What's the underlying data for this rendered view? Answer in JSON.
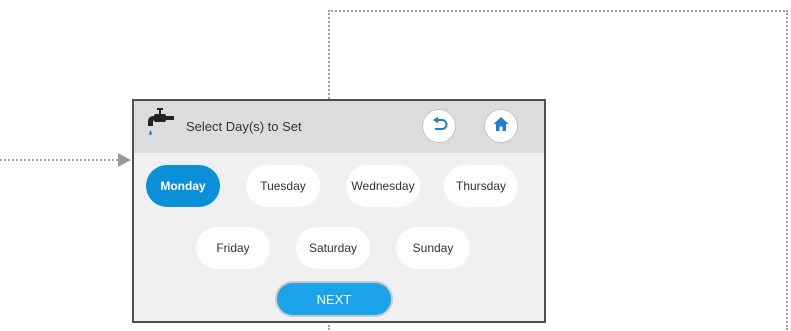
{
  "header": {
    "title": "Select Day(s) to Set",
    "icon": "water-tap-icon",
    "back_icon": "back-arrow-icon",
    "home_icon": "home-icon"
  },
  "days": [
    {
      "label": "Monday",
      "selected": true
    },
    {
      "label": "Tuesday",
      "selected": false
    },
    {
      "label": "Wednesday",
      "selected": false
    },
    {
      "label": "Thursday",
      "selected": false
    },
    {
      "label": "Friday",
      "selected": false
    },
    {
      "label": "Saturday",
      "selected": false
    },
    {
      "label": "Sunday",
      "selected": false
    }
  ],
  "footer": {
    "next_label": "NEXT"
  },
  "colors": {
    "accent": "#0a90d8",
    "next_button": "#1aa3e8",
    "header_bg": "#dcdcdc",
    "screen_bg": "#f0f0f0",
    "icon_blue": "#1e7fd0"
  }
}
